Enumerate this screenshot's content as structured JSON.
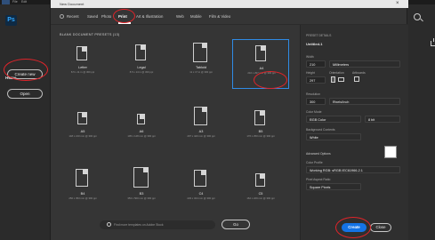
{
  "window": {
    "title": "New Document",
    "close_glyph": "×",
    "menu_items": [
      "File",
      "Edit"
    ]
  },
  "app": {
    "logo": "Ps",
    "home_label": "Home",
    "create_new_label": "Create new",
    "open_label": "Open"
  },
  "tabs": [
    {
      "label": "Recent"
    },
    {
      "label": "Saved"
    },
    {
      "label": "Photo"
    },
    {
      "label": "Print"
    },
    {
      "label": "Art & Illustration"
    },
    {
      "label": "Web"
    },
    {
      "label": "Mobile"
    },
    {
      "label": "Film & Video"
    }
  ],
  "active_tab": "Print",
  "presets_heading": "BLANK DOCUMENT PRESETS (13)",
  "presets": [
    {
      "name": "Letter",
      "sub": "8.5 x 11 in @ 300 ppi"
    },
    {
      "name": "Legal",
      "sub": "8.5 x 14 in @ 300 ppi"
    },
    {
      "name": "Tabloid",
      "sub": "11 x 17 in @ 300 ppi"
    },
    {
      "name": "A4",
      "sub": "210 x 297 mm @ 300 ppi"
    },
    {
      "name": "A5",
      "sub": "148 x 210 mm @ 300 ppi"
    },
    {
      "name": "A6",
      "sub": "105 x 148 mm @ 300 ppi"
    },
    {
      "name": "A3",
      "sub": "297 x 420 mm @ 300 ppi"
    },
    {
      "name": "B5",
      "sub": "176 x 250 mm @ 300 ppi"
    },
    {
      "name": "B4",
      "sub": "250 x 353 mm @ 300 ppi"
    },
    {
      "name": "B3",
      "sub": "353 x 500 mm @ 300 ppi"
    },
    {
      "name": "C4",
      "sub": "229 x 324 mm @ 300 ppi"
    },
    {
      "name": "C5",
      "sub": "162 x 229 mm @ 300 ppi"
    }
  ],
  "selected_preset": "A4",
  "bottom": {
    "search_placeholder": "Find more templates on Adobe Stock",
    "go_label": "Go"
  },
  "details": {
    "heading": "PRESET DETAILS",
    "doc_name": "Untitled-1",
    "width_label": "Width",
    "width_value": "210",
    "width_unit": "Millimeters",
    "height_label": "Height",
    "height_value": "297",
    "orientation_label": "Orientation",
    "artboards_label": "Artboards",
    "resolution_label": "Resolution",
    "resolution_value": "300",
    "resolution_unit": "Pixels/Inch",
    "color_mode_label": "Color Mode",
    "color_mode_value": "RGB Color",
    "bit_depth_value": "8 bit",
    "background_label": "Background Contents",
    "background_value": "White",
    "advanced_label": "Advanced Options",
    "color_profile_label": "Color Profile",
    "color_profile_value": "Working RGB: sRGB IEC61966-2.1",
    "pixel_aspect_label": "Pixel Aspect Ratio",
    "pixel_aspect_value": "Square Pixels"
  },
  "actions": {
    "create_label": "Create",
    "close_label": "Close"
  },
  "colors": {
    "accent": "#1473e6",
    "highlight_ring": "#e0242a",
    "selection": "#2f8be5"
  }
}
